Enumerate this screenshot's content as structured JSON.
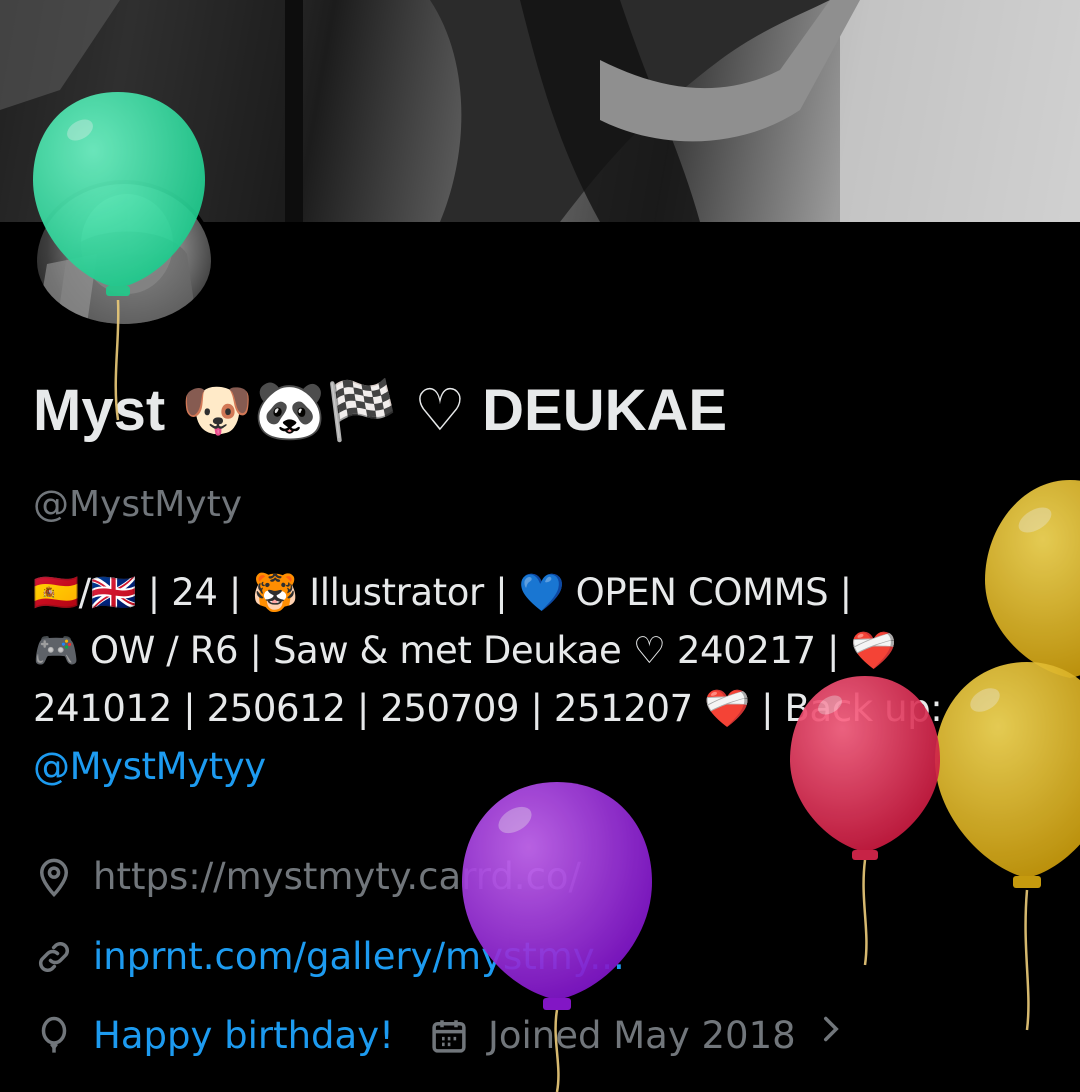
{
  "profile": {
    "display_name": "Myst 🐶🐼🏁 ♡ DEUKAE",
    "handle": "@MystMyty",
    "bio_lines": [
      "🇪🇸/🇬🇧 | 24 | 🐯 Illustrator | 💙 OPEN COMMS |",
      "🎮 OW / R6 | Saw & met Deukae ♡ 240217 | ❤️‍🩹",
      "241012 | 250612 | 250709 | 251207 ❤️‍🩹 | Back up:"
    ],
    "bio_mention": "@MystMytyy",
    "location": "https://mystmyty.carrd.co/",
    "website": "inprnt.com/gallery/mystmy...",
    "birthday": "Happy birthday!",
    "joined": "Joined May 2018"
  },
  "icons": {
    "location": "location-pin-icon",
    "link": "link-icon",
    "birthday": "balloon-icon",
    "joined": "calendar-icon",
    "chevron": "chevron-right-icon"
  },
  "colors": {
    "background": "#000000",
    "text_primary": "#e7e9ea",
    "text_secondary": "#71767b",
    "link": "#1d9bf0",
    "balloon_green": "#2ee0a0",
    "balloon_yellow": "#e8c020",
    "balloon_red": "#e8305a",
    "balloon_purple": "#a020e8"
  }
}
